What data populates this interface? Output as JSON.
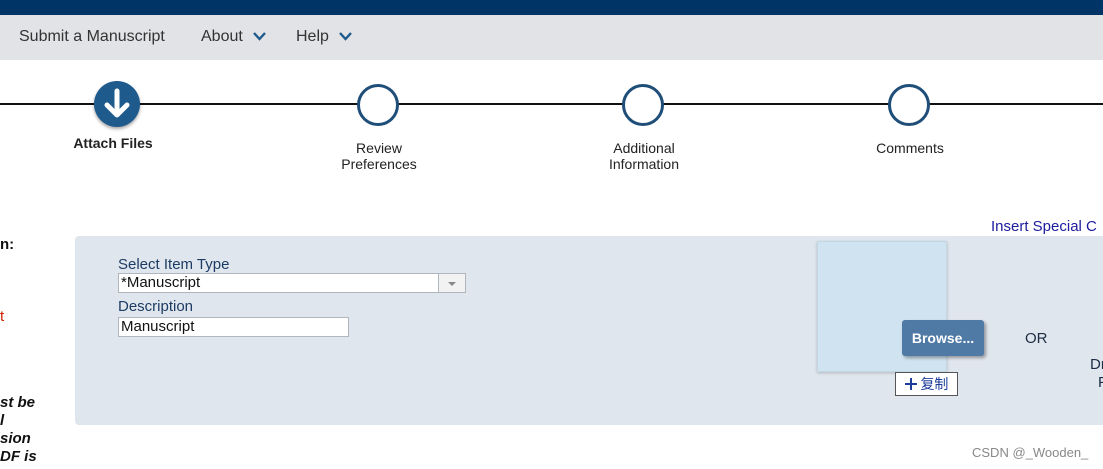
{
  "nav": {
    "items": [
      "Submit a Manuscript",
      "About",
      "Help"
    ]
  },
  "steps": [
    {
      "label": "Attach Files"
    },
    {
      "label_line1": "Review",
      "label_line2": "Preferences"
    },
    {
      "label_line1": "Additional",
      "label_line2": "Information"
    },
    {
      "label": "Comments"
    }
  ],
  "left_fragments": {
    "f1": "n:",
    "f2": "t",
    "f3": "st be",
    "f4": "l",
    "f5": "sion",
    "f6": "DF is"
  },
  "form": {
    "item_type_label": "Select Item Type",
    "item_type_value": "*Manuscript",
    "description_label": "Description",
    "description_value": "Manuscript"
  },
  "upload": {
    "browse_label": "Browse...",
    "copy_label": "复制",
    "or_label": "OR",
    "drag_fragment_1": "Dr",
    "drag_fragment_2": "F"
  },
  "insert_special": "Insert Special C",
  "watermark": "CSDN @_Wooden_",
  "colors": {
    "topbar": "#003366",
    "navbar": "#e1e3e6",
    "step_active": "#1f5a8c",
    "accent": "#1f4e79",
    "error_text": "#cc2200"
  }
}
